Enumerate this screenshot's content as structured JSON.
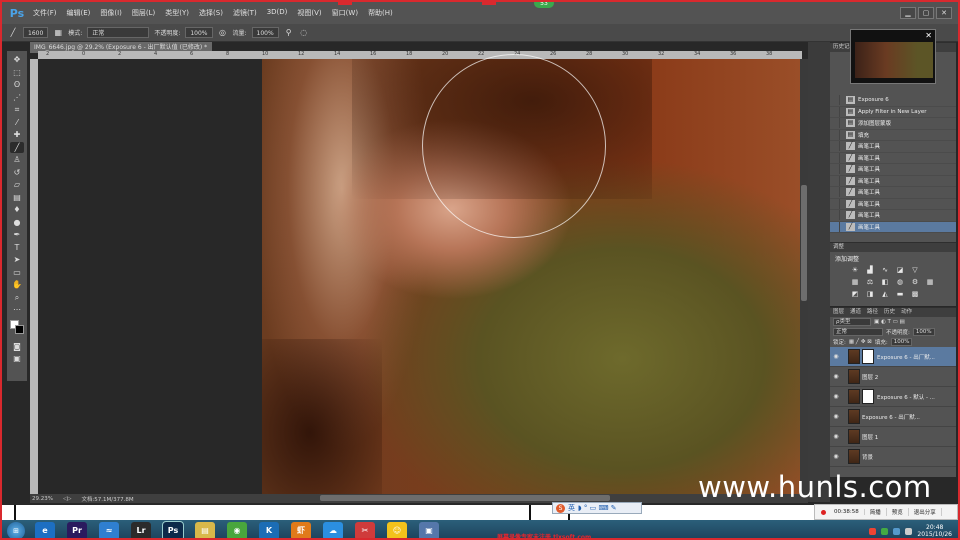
{
  "app": {
    "name": "Ps",
    "topbadge": "53"
  },
  "menu": [
    "文件(F)",
    "编辑(E)",
    "图像(I)",
    "图层(L)",
    "类型(Y)",
    "选择(S)",
    "滤镜(T)",
    "3D(D)",
    "视图(V)",
    "窗口(W)",
    "帮助(H)"
  ],
  "window_controls": {
    "minimize": "▁",
    "restore": "▢",
    "close": "✕"
  },
  "options": {
    "brush_size": "1600",
    "mode_label": "模式:",
    "mode_value": "正常",
    "opacity_label": "不透明度:",
    "opacity_value": "100%",
    "flow_label": "流量:",
    "flow_value": "100%"
  },
  "document": {
    "tab_title": "IMG_6646.jpg @ 29.2% (Exposure 6 - 出厂默认值 (已修改) *",
    "tab_close": "×",
    "zoom": "29.23%",
    "doc_size": "文档:57.1M/377.8M",
    "ruler_ticks": [
      "2",
      "0",
      "2",
      "4",
      "6",
      "8",
      "10",
      "12",
      "14",
      "16",
      "18",
      "20",
      "22",
      "24",
      "26",
      "28",
      "30",
      "32",
      "34",
      "36",
      "38"
    ]
  },
  "history": {
    "title": "历史记录",
    "items": [
      {
        "label": "Exposure 6",
        "selected": false
      },
      {
        "label": "Apply Filter in New Layer",
        "selected": false
      },
      {
        "label": "添加图层蒙版",
        "selected": false
      },
      {
        "label": "填充",
        "selected": false
      },
      {
        "label": "画笔工具",
        "selected": false
      },
      {
        "label": "画笔工具",
        "selected": false
      },
      {
        "label": "画笔工具",
        "selected": false
      },
      {
        "label": "画笔工具",
        "selected": false
      },
      {
        "label": "画笔工具",
        "selected": false
      },
      {
        "label": "画笔工具",
        "selected": false
      },
      {
        "label": "画笔工具",
        "selected": false
      },
      {
        "label": "画笔工具",
        "selected": true
      }
    ]
  },
  "adjustments": {
    "title": "调整",
    "add_label": "添加调整"
  },
  "layers_panel": {
    "tabs": [
      "图层",
      "通道",
      "路径",
      "历史",
      "动作"
    ],
    "filter_label": "ρ类型",
    "blend_mode": "正常",
    "opacity_label": "不透明度:",
    "opacity_value": "100%",
    "lock_label": "锁定:",
    "fill_label": "填充:",
    "fill_value": "100%",
    "layers": [
      {
        "name": "Exposure 6 - 出厂默...",
        "mask": true,
        "selected": true
      },
      {
        "name": "图层 2",
        "mask": false,
        "selected": false
      },
      {
        "name": "Exposure 6 - 默认 - ...",
        "mask": true,
        "selected": false
      },
      {
        "name": "Exposure 6 - 出厂默...",
        "mask": false,
        "selected": false
      },
      {
        "name": "图层 1",
        "mask": false,
        "selected": false
      },
      {
        "name": "背景",
        "mask": false,
        "selected": false
      }
    ]
  },
  "watermark": "www.hunls.com",
  "recorder": {
    "time": "00:38:58",
    "buttons": [
      "简播",
      "预览",
      "退出分享"
    ]
  },
  "ime": {
    "label": "英"
  },
  "taskbar": {
    "apps": [
      "e",
      "Pr",
      "≈",
      "Lr",
      "Ps",
      "▤",
      "◉",
      "K",
      "虾",
      "☁",
      "✂",
      "☺",
      "▣"
    ],
    "time": "20:48",
    "date": "2015/10/26"
  },
  "footer_text": "屏幕录像专家未注册 tlxsoft.com",
  "colors": {
    "accent": "#5b7aa0",
    "frame": "#d9292e",
    "ps_blue": "#4aa3e8"
  }
}
